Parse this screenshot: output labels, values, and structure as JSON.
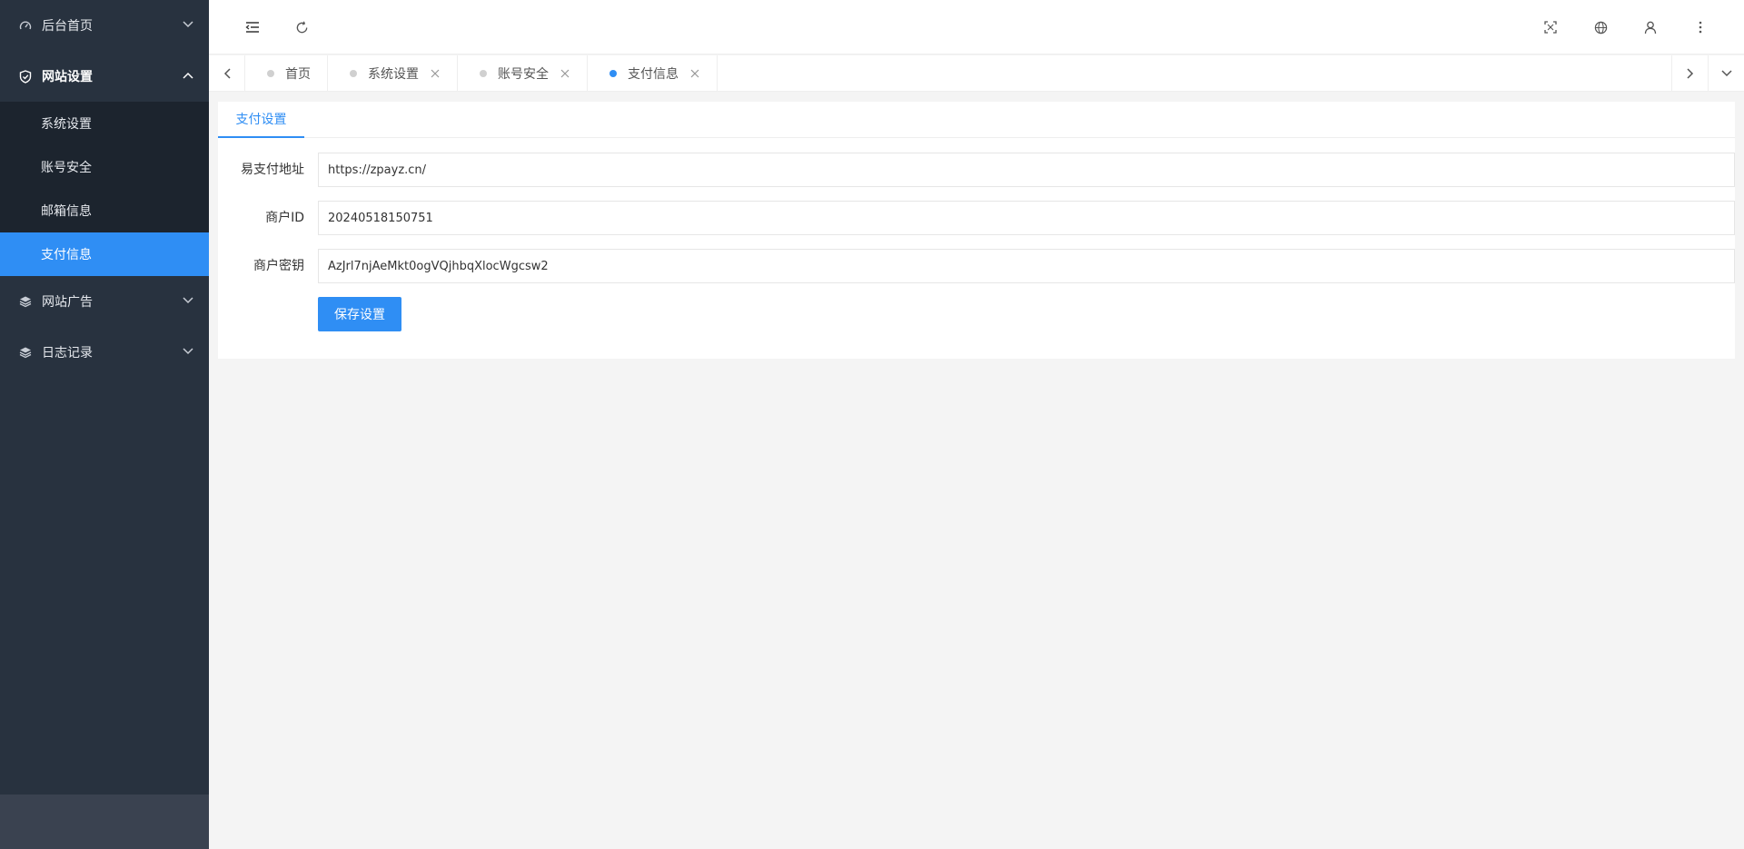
{
  "sidebar": {
    "home": {
      "label": "后台首页",
      "icon": "dashboard-icon"
    },
    "site_settings": {
      "label": "网站设置",
      "icon": "shield-icon",
      "items": [
        {
          "label": "系统设置"
        },
        {
          "label": "账号安全"
        },
        {
          "label": "邮箱信息"
        },
        {
          "label": "支付信息"
        }
      ]
    },
    "ads": {
      "label": "网站广告",
      "icon": "layers-icon"
    },
    "logs": {
      "label": "日志记录",
      "icon": "layers-icon"
    }
  },
  "tabs": [
    {
      "label": "首页",
      "closable": false,
      "active": false
    },
    {
      "label": "系统设置",
      "closable": true,
      "active": false
    },
    {
      "label": "账号安全",
      "closable": true,
      "active": false
    },
    {
      "label": "支付信息",
      "closable": true,
      "active": true
    }
  ],
  "card": {
    "tab_label": "支付设置",
    "fields": [
      {
        "label": "易支付地址",
        "value": "https://zpayz.cn/"
      },
      {
        "label": "商户ID",
        "value": "20240518150751"
      },
      {
        "label": "商户密钥",
        "value": "AzJrl7njAeMkt0ogVQjhbqXlocWgcsw2"
      }
    ],
    "save_label": "保存设置"
  },
  "colors": {
    "accent": "#2f8ef4",
    "sidebar_bg": "#28323f",
    "submenu_bg": "#1c242e"
  }
}
